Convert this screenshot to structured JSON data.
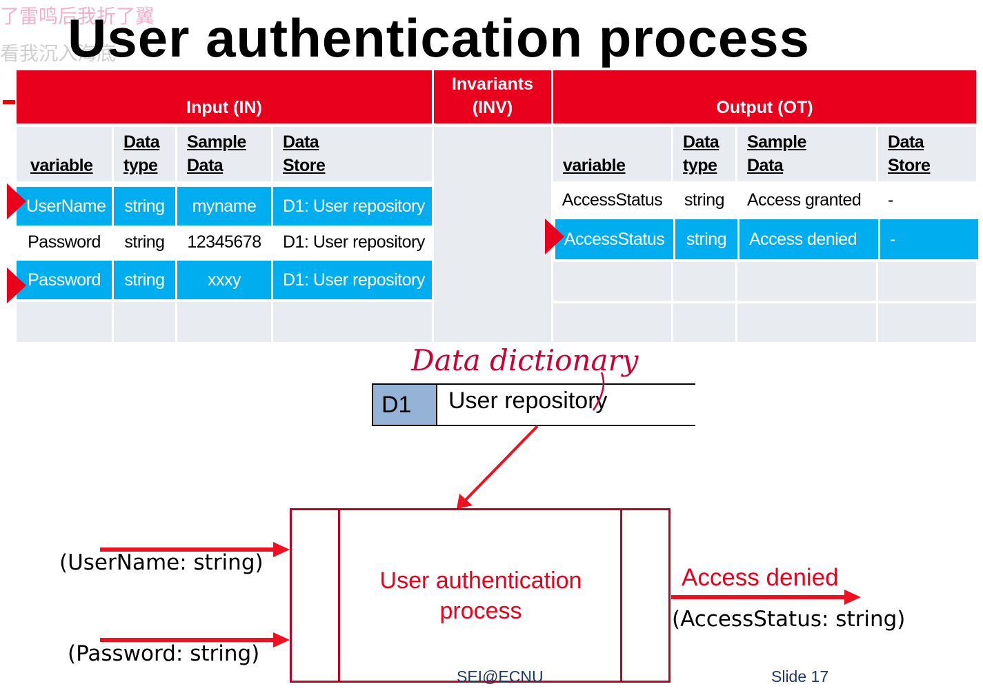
{
  "overlay": {
    "line1": "了雷鸣后我折了翼",
    "line2": "看我沉入海底"
  },
  "title": "User authentication process",
  "table": {
    "input_header": "Input (IN)",
    "invariants_header": "Invariants (INV)",
    "output_header": "Output (OT)",
    "input_columns": [
      "variable",
      "Data type",
      "Sample Data",
      "Data Store"
    ],
    "input_rows": [
      {
        "variable": "UserName",
        "type": "string",
        "sample": "myname",
        "store": "D1: User repository",
        "highlighted": true
      },
      {
        "variable": "Password",
        "type": "string",
        "sample": "12345678",
        "store": "D1: User repository",
        "highlighted": false
      },
      {
        "variable": "Password",
        "type": "string",
        "sample": "xxxy",
        "store": "D1: User repository",
        "highlighted": true
      }
    ],
    "output_columns": [
      "variable",
      "Data type",
      "Sample Data",
      "Data Store"
    ],
    "output_rows": [
      {
        "variable": "AccessStatus",
        "type": "string",
        "sample": "Access granted",
        "store": "-",
        "highlighted": false
      },
      {
        "variable": "AccessStatus",
        "type": "string",
        "sample": "Access denied",
        "store": "-",
        "highlighted": true
      }
    ]
  },
  "handwriting": "Data dictionary",
  "data_store": {
    "id": "D1",
    "name": "User repository"
  },
  "process": {
    "name": "User authentication process"
  },
  "flows": {
    "input1": "(UserName: string)",
    "input2": "(Password: string)",
    "output_label": "Access denied",
    "output_flow": "(AccessStatus: string)"
  },
  "footer": {
    "org": "SEI@ECNU",
    "slide": "Slide  17"
  },
  "colors": {
    "header_red": "#e8001c",
    "highlight_blue": "#00aeef",
    "row_light": "#e8ecf1",
    "store_id_fill": "#95b3d7",
    "process_border": "#c00020"
  }
}
